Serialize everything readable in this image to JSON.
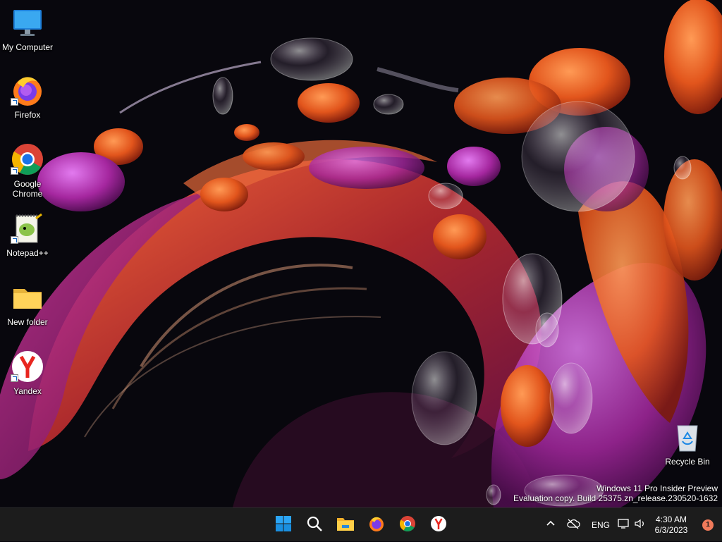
{
  "desktop": {
    "icons": [
      {
        "label": "My Computer",
        "icon": "monitor-icon"
      },
      {
        "label": "Firefox",
        "icon": "firefox-icon"
      },
      {
        "label": "Google Chrome",
        "icon": "chrome-icon"
      },
      {
        "label": "Notepad++",
        "icon": "notepadpp-icon"
      },
      {
        "label": "New folder",
        "icon": "folder-icon"
      },
      {
        "label": "Yandex",
        "icon": "yandex-icon"
      },
      {
        "label": "Recycle Bin",
        "icon": "recycle-bin-icon"
      }
    ],
    "watermark": {
      "line1": "Windows 11 Pro Insider Preview",
      "line2": "Evaluation copy. Build 25375.zn_release.230520-1632"
    }
  },
  "taskbar": {
    "pinned": [
      {
        "name": "start-button",
        "icon": "windows-logo-icon"
      },
      {
        "name": "search-button",
        "icon": "search-icon"
      },
      {
        "name": "file-explorer-button",
        "icon": "folder-icon"
      },
      {
        "name": "firefox-button",
        "icon": "firefox-icon"
      },
      {
        "name": "chrome-button",
        "icon": "chrome-icon"
      },
      {
        "name": "yandex-button",
        "icon": "yandex-icon"
      }
    ],
    "tray": {
      "language": "ENG",
      "time": "4:30 AM",
      "date": "6/3/2023",
      "notification_count": "1"
    }
  },
  "colors": {
    "taskbar_bg": "#1c1c1c",
    "accent_blue": "#0a84ff",
    "badge": "#f07a5a"
  }
}
